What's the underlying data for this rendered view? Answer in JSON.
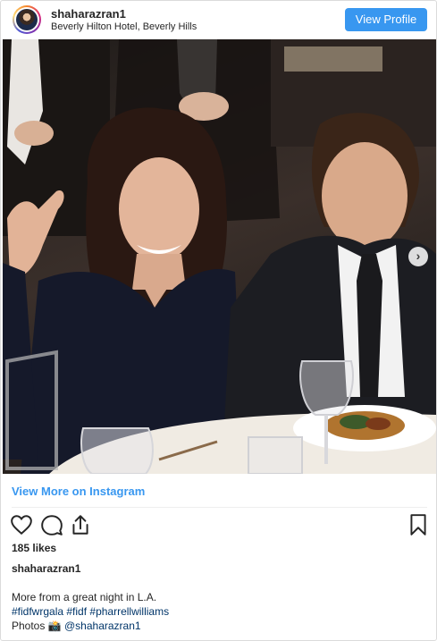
{
  "header": {
    "username": "shaharazran1",
    "location": "Beverly Hilton Hotel, Beverly Hills",
    "view_profile_label": "View Profile"
  },
  "post": {
    "next_arrow_glyph": "›",
    "view_more_label": "View More on Instagram",
    "likes": "185 likes",
    "caption_username": "shaharazran1",
    "caption_text": "More from a great night in L.A.",
    "hashtags": [
      "#fidfwrgala",
      "#fidf",
      "#pharrellwilliams"
    ],
    "photos_prefix": "Photos",
    "camera_emoji": "📸",
    "photos_mention": "@shaharazran1"
  },
  "icons": {
    "like": "heart-icon",
    "comment": "comment-icon",
    "share": "share-icon",
    "save": "bookmark-icon"
  },
  "colors": {
    "accent": "#3897f0",
    "text": "#262626",
    "hashtag": "#003569"
  }
}
